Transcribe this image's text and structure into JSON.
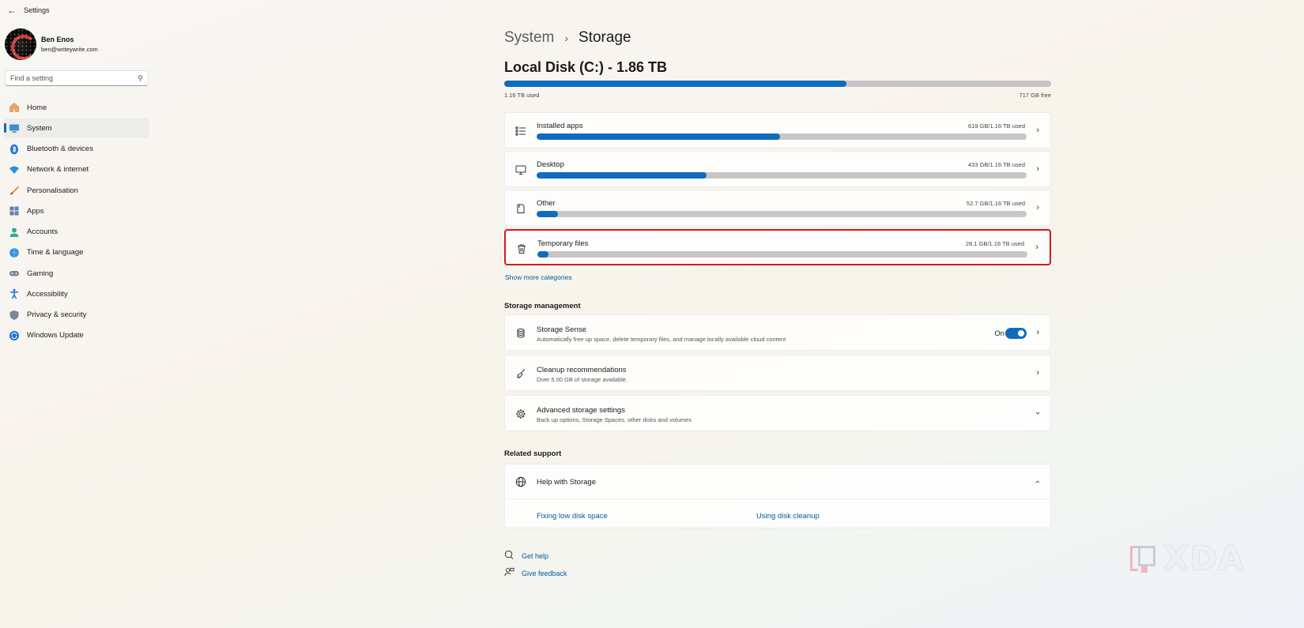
{
  "window": {
    "title": "Settings"
  },
  "profile": {
    "name": "Ben Enos",
    "email": "ben@writeywrite.com"
  },
  "search": {
    "placeholder": "Find a setting"
  },
  "nav": {
    "items": [
      {
        "label": "Home",
        "icon": "home-icon",
        "active": false
      },
      {
        "label": "System",
        "icon": "monitor-icon",
        "active": true
      },
      {
        "label": "Bluetooth & devices",
        "icon": "bluetooth-icon",
        "active": false
      },
      {
        "label": "Network & internet",
        "icon": "wifi-icon",
        "active": false
      },
      {
        "label": "Personalisation",
        "icon": "brush-icon",
        "active": false
      },
      {
        "label": "Apps",
        "icon": "apps-icon",
        "active": false
      },
      {
        "label": "Accounts",
        "icon": "person-icon",
        "active": false
      },
      {
        "label": "Time & language",
        "icon": "globe-clock-icon",
        "active": false
      },
      {
        "label": "Gaming",
        "icon": "gamepad-icon",
        "active": false
      },
      {
        "label": "Accessibility",
        "icon": "accessibility-icon",
        "active": false
      },
      {
        "label": "Privacy & security",
        "icon": "shield-icon",
        "active": false
      },
      {
        "label": "Windows Update",
        "icon": "update-icon",
        "active": false
      }
    ]
  },
  "breadcrumb": {
    "parent": "System",
    "separator": "›",
    "current": "Storage"
  },
  "disk": {
    "title": "Local Disk (C:) - 1.86 TB",
    "used": "1.16 TB used",
    "free": "717 GB free",
    "used_fraction": 0.625
  },
  "categories": [
    {
      "name": "Installed apps",
      "size": "619 GB/1.16 TB used",
      "fraction": 0.497,
      "icon": "list-icon",
      "highlighted": false
    },
    {
      "name": "Desktop",
      "size": "433 GB/1.16 TB used",
      "fraction": 0.347,
      "icon": "desktop-icon",
      "highlighted": false
    },
    {
      "name": "Other",
      "size": "52.7 GB/1.16 TB used",
      "fraction": 0.043,
      "icon": "document-icon",
      "highlighted": false
    },
    {
      "name": "Temporary files",
      "size": "28.1 GB/1.16 TB used",
      "fraction": 0.023,
      "icon": "trash-icon",
      "highlighted": true
    }
  ],
  "show_more": "Show more categories",
  "storage_management": {
    "title": "Storage management",
    "items": [
      {
        "title": "Storage Sense",
        "desc": "Automatically free up space, delete temporary files, and manage locally available cloud content",
        "icon": "storage-sense-icon",
        "toggle_label": "On",
        "toggle_on": true,
        "chevron": "right"
      },
      {
        "title": "Cleanup recommendations",
        "desc": "Over 5.00 GB of storage available.",
        "icon": "broom-icon",
        "chevron": "right"
      },
      {
        "title": "Advanced storage settings",
        "desc": "Back up options, Storage Spaces, other disks and volumes",
        "icon": "gear-icon",
        "chevron": "down"
      }
    ]
  },
  "related_support": {
    "title": "Related support",
    "help_title": "Help with Storage",
    "links": [
      "Fixing low disk space",
      "Using disk cleanup"
    ]
  },
  "footer": {
    "get_help": "Get help",
    "give_feedback": "Give feedback"
  },
  "watermark": {
    "text": "XDA"
  },
  "colors": {
    "accent": "#0f6cbd",
    "highlight_border": "#d7191c",
    "bar_track": "#c6c6c6",
    "link": "#005a9e"
  }
}
